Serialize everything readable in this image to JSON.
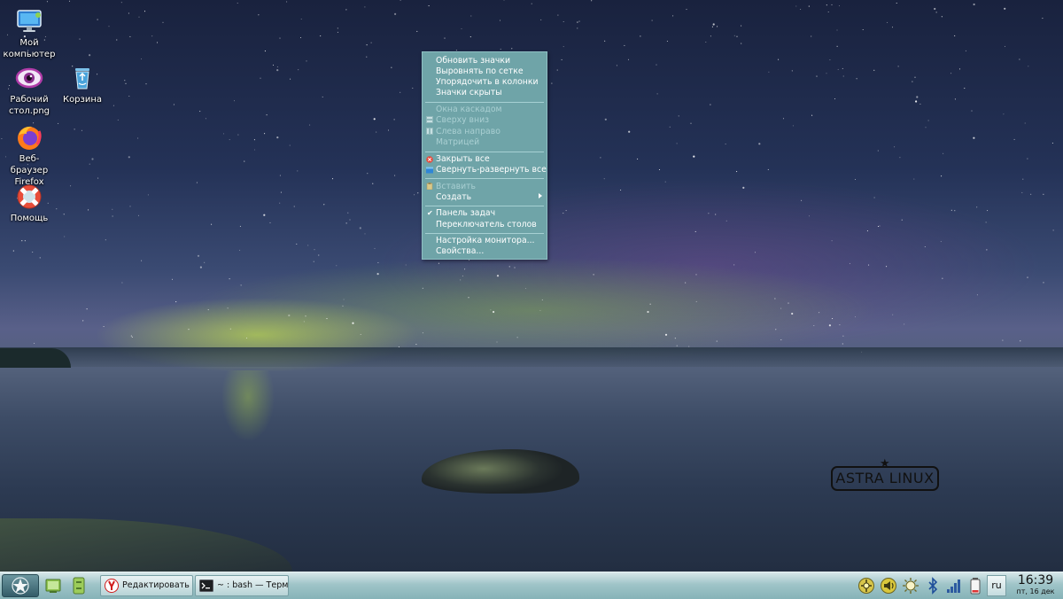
{
  "desktop": {
    "icons": [
      {
        "name": "my-computer",
        "label": "Мой компьютер",
        "icon": "monitor-icon"
      },
      {
        "name": "desktop-png",
        "label": "Рабочий стол.png",
        "icon": "eye-image-icon"
      },
      {
        "name": "trash",
        "label": "Корзина",
        "icon": "trash-icon"
      },
      {
        "name": "firefox",
        "label": "Веб-браузер Firefox",
        "icon": "firefox-icon"
      },
      {
        "name": "help",
        "label": "Помощь",
        "icon": "lifebuoy-icon"
      }
    ],
    "logo_text": "ASTRA LINUX"
  },
  "context_menu": {
    "refresh_icons": "Обновить значки",
    "align_grid": "Выровнять по сетке",
    "arrange_columns": "Упорядочить в колонки",
    "icons_hidden": "Значки скрыты",
    "cascade": "Окна каскадом",
    "top_down": "Сверху вниз",
    "left_right": "Слева направо",
    "matrix": "Матрицей",
    "close_all": "Закрыть все",
    "minimize_all": "Свернуть-развернуть все",
    "paste": "Вставить",
    "create": "Создать",
    "taskbar": "Панель задач",
    "desk_switcher": "Переключатель столов",
    "monitor_settings": "Настройка монитора...",
    "properties": "Свойства...",
    "disabled_items": [
      "Окна каскадом",
      "Сверху вниз",
      "Слева направо",
      "Матрицей",
      "Вставить"
    ],
    "checked_items": [
      "Панель задач"
    ]
  },
  "taskbar": {
    "tasks": [
      {
        "label": "Редактировать ...",
        "icon": "yandex-browser-icon"
      },
      {
        "label": "~ : bash — Терм...",
        "icon": "terminal-icon"
      }
    ],
    "tray_icons": [
      "network-icon",
      "volume-icon",
      "brightness-icon",
      "bluetooth-icon",
      "signal-icon",
      "battery-icon"
    ],
    "language": "ru",
    "time": "16:39",
    "date": "пт, 16 дек"
  },
  "colors": {
    "menu_bg": "#6fa4a8",
    "taskbar_top": "#d7e7e9",
    "taskbar_bottom": "#86b3b8"
  }
}
